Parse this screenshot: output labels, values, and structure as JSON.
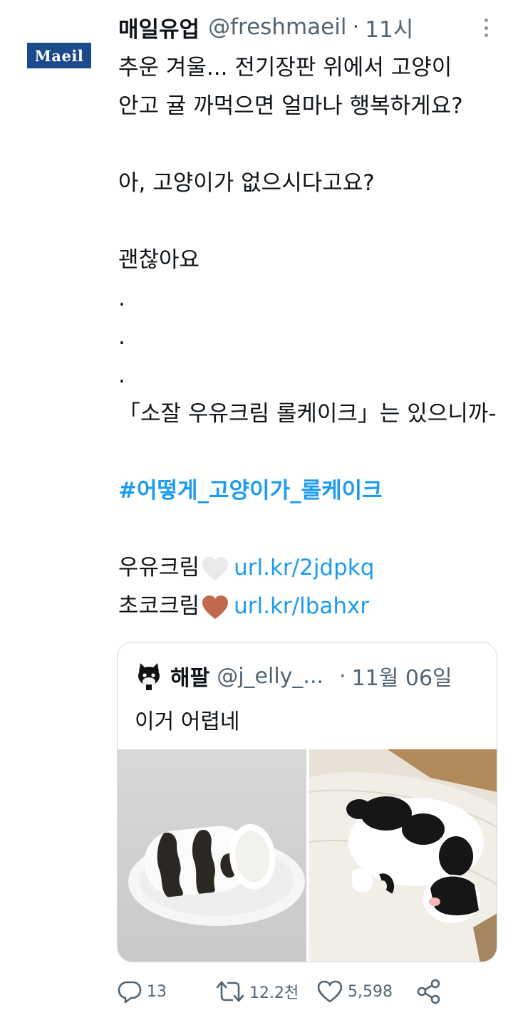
{
  "tweet": {
    "avatar_label": "Maeil",
    "name": "매일유업",
    "handle": "@freshmaeil",
    "separator": "·",
    "time": "11시",
    "lines": [
      "추운 겨울... 전기장판 위에서 고양이",
      "안고 귤 까먹으면 얼마나 행복하게요?",
      "",
      "아, 고양이가 없으시다고요?",
      "",
      "괜찮아요",
      ".",
      ".",
      ".",
      "「소잘 우유크림 롤케이크」는 있으니까-",
      ""
    ],
    "hashtag": "#어떻게_고양이가_롤케이크",
    "milk_label": "우유크림",
    "milk_link": "url.kr/2jdpkq",
    "choco_label": "초코크림",
    "choco_link": "url.kr/lbahxr",
    "colors": {
      "link": "#1d9bf0",
      "white_heart": "#e7e9ea",
      "brown_heart": "#c1694f",
      "brand": "#1a4a8c"
    }
  },
  "quote": {
    "name": "해팔",
    "handle": "@j_elly_...",
    "separator": "·",
    "time": "11월 06일",
    "text": "이거 어렵네"
  },
  "actions": {
    "replies": "13",
    "retweets": "12.2천",
    "likes": "5,598"
  }
}
